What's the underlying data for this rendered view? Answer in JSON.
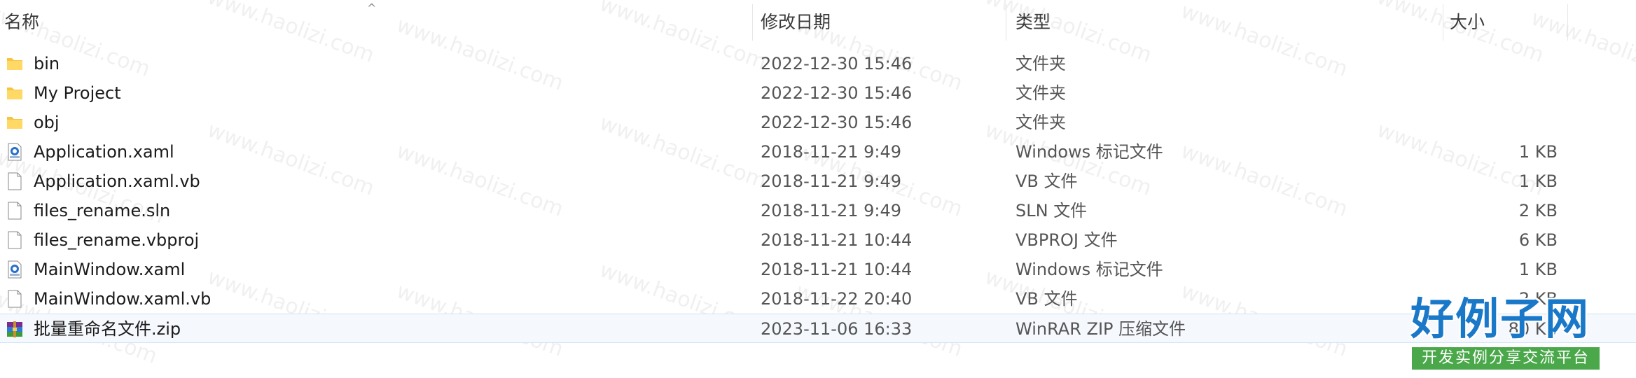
{
  "header": {
    "name": "名称",
    "date": "修改日期",
    "type": "类型",
    "size": "大小",
    "sort_indicator": "^"
  },
  "files": [
    {
      "icon": "folder-icon",
      "name": "bin",
      "date": "2022-12-30 15:46",
      "type": "文件夹",
      "size": ""
    },
    {
      "icon": "folder-icon",
      "name": "My Project",
      "date": "2022-12-30 15:46",
      "type": "文件夹",
      "size": ""
    },
    {
      "icon": "folder-icon",
      "name": "obj",
      "date": "2022-12-30 15:46",
      "type": "文件夹",
      "size": ""
    },
    {
      "icon": "xaml-file-icon",
      "name": "Application.xaml",
      "date": "2018-11-21 9:49",
      "type": "Windows 标记文件",
      "size": "1 KB"
    },
    {
      "icon": "file-icon",
      "name": "Application.xaml.vb",
      "date": "2018-11-21 9:49",
      "type": "VB 文件",
      "size": "1 KB"
    },
    {
      "icon": "file-icon",
      "name": "files_rename.sln",
      "date": "2018-11-21 9:49",
      "type": "SLN 文件",
      "size": "2 KB"
    },
    {
      "icon": "file-icon",
      "name": "files_rename.vbproj",
      "date": "2018-11-21 10:44",
      "type": "VBPROJ 文件",
      "size": "6 KB"
    },
    {
      "icon": "xaml-file-icon",
      "name": "MainWindow.xaml",
      "date": "2018-11-21 10:44",
      "type": "Windows 标记文件",
      "size": "1 KB"
    },
    {
      "icon": "file-icon",
      "name": "MainWindow.xaml.vb",
      "date": "2018-11-22 20:40",
      "type": "VB 文件",
      "size": "2 KB"
    },
    {
      "icon": "winrar-archive-icon",
      "name": "批量重命名文件.zip",
      "date": "2023-11-06 16:33",
      "type": "WinRAR ZIP 压缩文件",
      "size": "80 KB"
    }
  ],
  "watermark": "www.haolizi.com",
  "logo": {
    "title": "好例子网",
    "subtitle": "开发实例分享交流平台"
  },
  "colors": {
    "folder": "#f5c542",
    "selection_bg": "#f5f9fd",
    "selection_border": "#cce4f7",
    "logo_blue": "#1a78c8",
    "logo_green": "#4aa84a"
  }
}
